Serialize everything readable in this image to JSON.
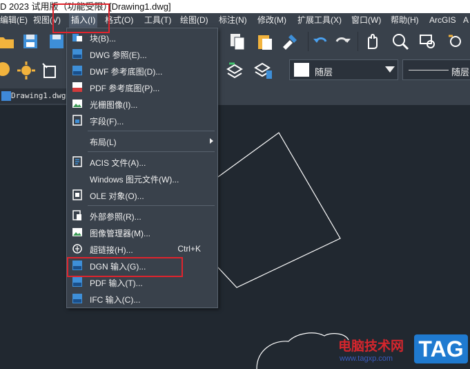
{
  "window": {
    "title_left": "D 2023 试用版（功能受限）",
    "title_file": "[Drawing1.dwg]"
  },
  "menubar": {
    "items": [
      {
        "label": "编辑(E)"
      },
      {
        "label": "视图(V)"
      },
      {
        "label": "插入(I)"
      },
      {
        "label": "格式(O)"
      },
      {
        "label": "工具(T)"
      },
      {
        "label": "绘图(D)"
      },
      {
        "label": "标注(N)"
      },
      {
        "label": "修改(M)"
      },
      {
        "label": "扩展工具(X)"
      },
      {
        "label": "窗口(W)"
      },
      {
        "label": "帮助(H)"
      },
      {
        "label": "ArcGIS"
      },
      {
        "label": "A"
      }
    ],
    "active_index": 2
  },
  "toolbar": {
    "layer_name": "随层",
    "linetype_name": "随层"
  },
  "document": {
    "tab_label": "Drawing1.dwg"
  },
  "insert_menu": {
    "items": [
      {
        "label": "块(B)...",
        "icon": "block-icon",
        "shortcut": "",
        "submenu": false
      },
      {
        "label": "DWG 参照(E)...",
        "icon": "dwg-reference-icon",
        "shortcut": "",
        "submenu": false
      },
      {
        "label": "DWF 参考底图(D)...",
        "icon": "dwf-underlay-icon",
        "shortcut": "",
        "submenu": false
      },
      {
        "label": "PDF 参考底图(P)...",
        "icon": "pdf-underlay-icon",
        "shortcut": "",
        "submenu": false
      },
      {
        "label": "光栅图像(I)...",
        "icon": "raster-image-icon",
        "shortcut": "",
        "submenu": false
      },
      {
        "label": "字段(F)...",
        "icon": "field-icon",
        "shortcut": "",
        "submenu": false
      },
      {
        "label": "布局(L)",
        "icon": "",
        "shortcut": "",
        "submenu": true
      },
      {
        "label": "ACIS 文件(A)...",
        "icon": "acis-file-icon",
        "shortcut": "",
        "submenu": false
      },
      {
        "label": "Windows 图元文件(W)...",
        "icon": "",
        "shortcut": "",
        "submenu": false
      },
      {
        "label": "OLE 对象(O)...",
        "icon": "ole-object-icon",
        "shortcut": "",
        "submenu": false
      },
      {
        "label": "外部参照(R)...",
        "icon": "external-reference-icon",
        "shortcut": "",
        "submenu": false
      },
      {
        "label": "图像管理器(M)...",
        "icon": "image-manager-icon",
        "shortcut": "",
        "submenu": false
      },
      {
        "label": "超链接(H)...",
        "icon": "hyperlink-icon",
        "shortcut": "Ctrl+K",
        "submenu": false
      },
      {
        "label": "DGN 输入(G)...",
        "icon": "dgn-import-icon",
        "shortcut": "",
        "submenu": false
      },
      {
        "label": "PDF 输入(T)...",
        "icon": "pdf-import-icon",
        "shortcut": "",
        "submenu": false
      },
      {
        "label": "IFC 输入(C)...",
        "icon": "ifc-import-icon",
        "shortcut": "",
        "submenu": false
      }
    ]
  },
  "watermark": {
    "site_name": "电脑技术网",
    "url": "www.tagxp.com",
    "badge": "TAG"
  },
  "colors": {
    "accent_red": "#e0242d",
    "menu_bg": "#39414b",
    "canvas_bg": "#212830"
  }
}
